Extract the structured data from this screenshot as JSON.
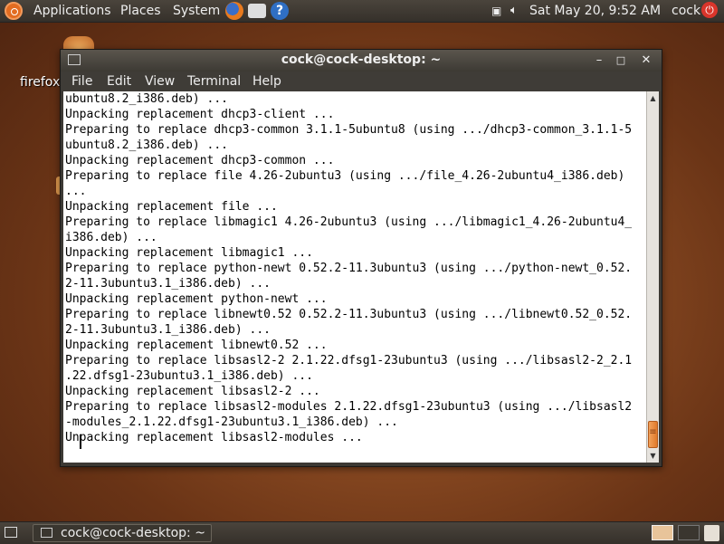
{
  "top_panel": {
    "menus": [
      "Applications",
      "Places",
      "System"
    ],
    "clock": "Sat May 20,  9:52 AM",
    "user": "cock",
    "icons": [
      "ubuntu-logo-icon",
      "firefox-icon",
      "mail-icon",
      "help-icon",
      "display-icon",
      "volume-icon",
      "power-icon"
    ]
  },
  "desktop": {
    "icon_label": "firefox"
  },
  "window": {
    "title": "cock@cock-desktop: ~",
    "menu": [
      "File",
      "Edit",
      "View",
      "Terminal",
      "Help"
    ],
    "buttons": [
      "minimize",
      "maximize",
      "close"
    ],
    "lines": [
      "ubuntu8.2_i386.deb) ...",
      "Unpacking replacement dhcp3-client ...",
      "Preparing to replace dhcp3-common 3.1.1-5ubuntu8 (using .../dhcp3-common_3.1.1-5",
      "ubuntu8.2_i386.deb) ...",
      "Unpacking replacement dhcp3-common ...",
      "Preparing to replace file 4.26-2ubuntu3 (using .../file_4.26-2ubuntu4_i386.deb)",
      "...",
      "Unpacking replacement file ...",
      "Preparing to replace libmagic1 4.26-2ubuntu3 (using .../libmagic1_4.26-2ubuntu4_",
      "i386.deb) ...",
      "Unpacking replacement libmagic1 ...",
      "Preparing to replace python-newt 0.52.2-11.3ubuntu3 (using .../python-newt_0.52.",
      "2-11.3ubuntu3.1_i386.deb) ...",
      "Unpacking replacement python-newt ...",
      "Preparing to replace libnewt0.52 0.52.2-11.3ubuntu3 (using .../libnewt0.52_0.52.",
      "2-11.3ubuntu3.1_i386.deb) ...",
      "Unpacking replacement libnewt0.52 ...",
      "Preparing to replace libsasl2-2 2.1.22.dfsg1-23ubuntu3 (using .../libsasl2-2_2.1",
      ".22.dfsg1-23ubuntu3.1_i386.deb) ...",
      "Unpacking replacement libsasl2-2 ...",
      "Preparing to replace libsasl2-modules 2.1.22.dfsg1-23ubuntu3 (using .../libsasl2",
      "-modules_2.1.22.dfsg1-23ubuntu3.1_i386.deb) ...",
      "Unpacking replacement libsasl2-modules ..."
    ]
  },
  "bottom_panel": {
    "task_label": "cock@cock-desktop: ~"
  },
  "colors": {
    "panel": "#3d3832",
    "accent": "#e07a2b",
    "desktop": "#8a4a22"
  }
}
